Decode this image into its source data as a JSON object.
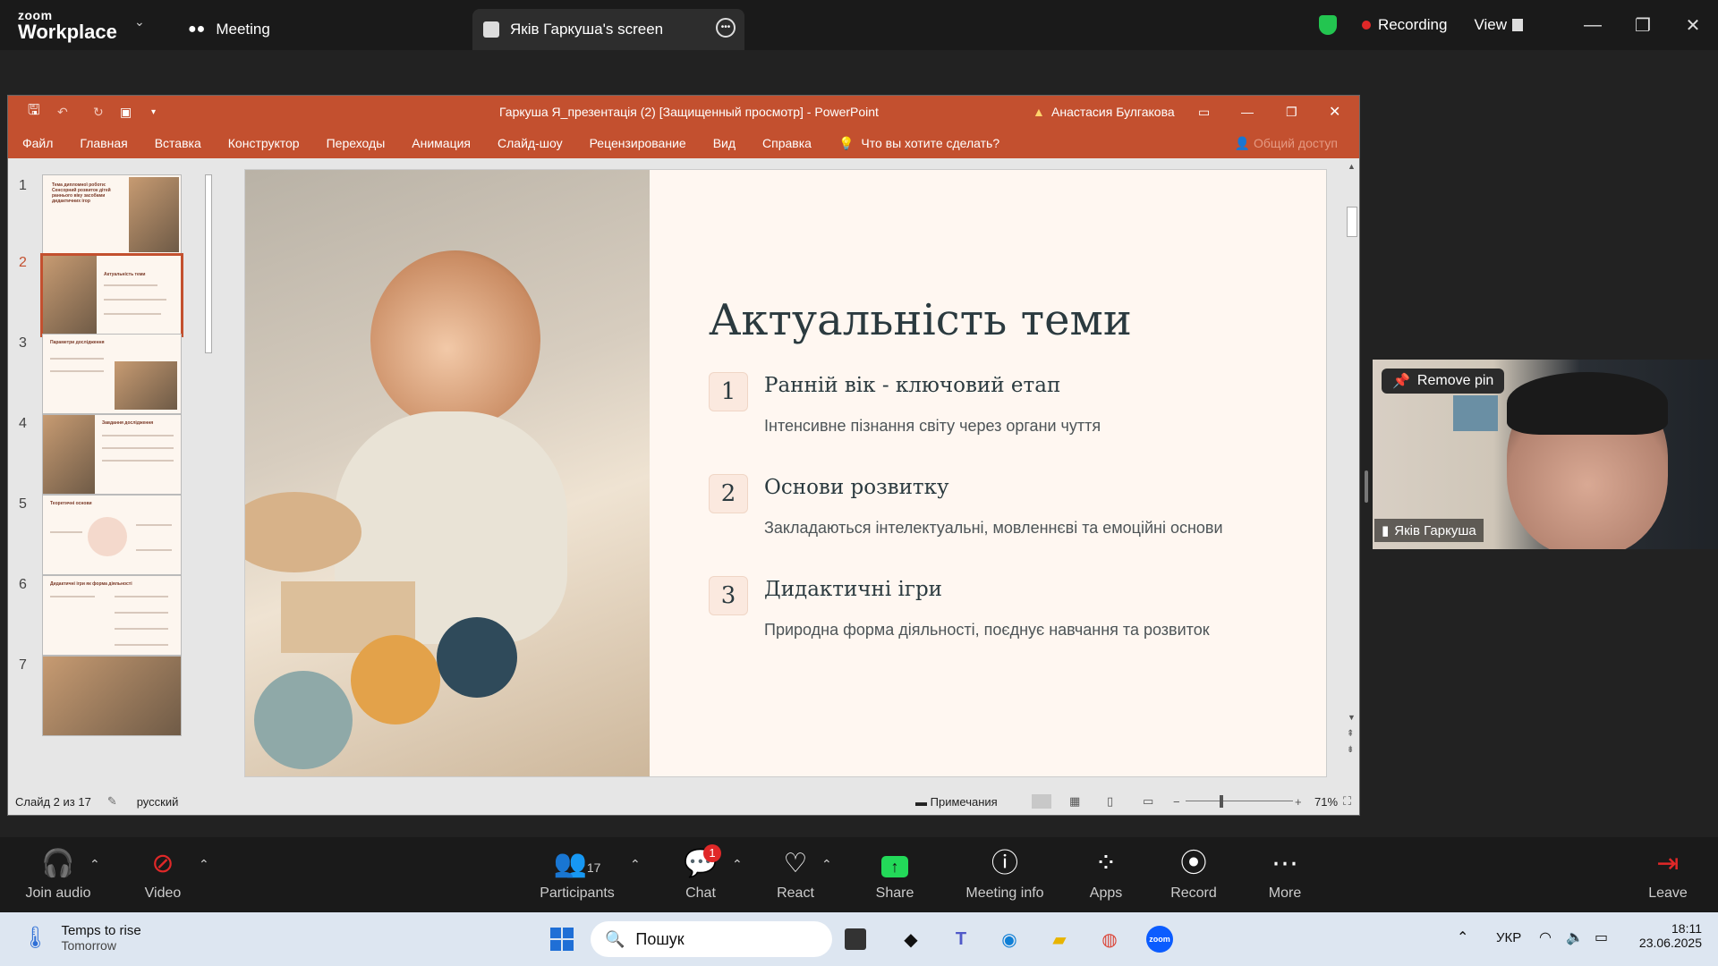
{
  "zoom": {
    "logo_line1": "zoom",
    "logo_line2": "Workplace",
    "meeting_tab": "Meeting",
    "share_tab": "Якiв Гаркуша's screen",
    "recording": "Recording",
    "view": "View"
  },
  "ppt": {
    "title": "Гаркуша Я_презентація (2) [Защищенный просмотр] - PowerPoint",
    "user": "Анастасия Булгакова",
    "ribbon": [
      "Файл",
      "Главная",
      "Вставка",
      "Конструктор",
      "Переходы",
      "Анимация",
      "Слайд-шоу",
      "Рецензирование",
      "Вид",
      "Справка"
    ],
    "tell_me": "Что вы хотите сделать?",
    "share": "Общий доступ",
    "thumbnails": [
      {
        "num": "1",
        "label": "Тема дипломної роботи: Сенсорний розвиток дітей раннього віку засобами дидактичних ігор"
      },
      {
        "num": "2",
        "label": "Актуальність теми"
      },
      {
        "num": "3",
        "label": "Параметри дослідження"
      },
      {
        "num": "4",
        "label": "Завдання дослідження"
      },
      {
        "num": "5",
        "label": "Теоретичні основи"
      },
      {
        "num": "6",
        "label": "Дидактичні ігри як форма діяльності"
      },
      {
        "num": "7",
        "label": ""
      }
    ],
    "slide": {
      "title": "Актуальність теми",
      "points": [
        {
          "num": "1",
          "title": "Ранній вік - ключовий етап",
          "desc": "Інтенсивне пізнання світу через органи чуття"
        },
        {
          "num": "2",
          "title": "Основи розвитку",
          "desc": "Закладаються інтелектуальні, мовленнєві та емоційні основи"
        },
        {
          "num": "3",
          "title": "Дидактичні ігри",
          "desc": "Природна форма діяльності, поєднує навчання та розвиток"
        }
      ]
    },
    "status": {
      "slide_of": "Слайд 2 из 17",
      "language": "русский",
      "notes": "Примечания",
      "zoom": "71%"
    }
  },
  "video": {
    "remove_pin": "Remove pin",
    "name": "Якiв Гаркуша"
  },
  "toolbar": {
    "join_audio": "Join audio",
    "video": "Video",
    "participants": "Participants",
    "participants_count": "17",
    "chat": "Chat",
    "chat_badge": "1",
    "react": "React",
    "share": "Share",
    "meeting_info": "Meeting info",
    "apps": "Apps",
    "record": "Record",
    "more": "More",
    "leave": "Leave"
  },
  "taskbar": {
    "weather_title": "Temps to rise",
    "weather_sub": "Tomorrow",
    "search": "Пошук",
    "lang": "УКР",
    "time": "18:11",
    "date": "23.06.2025"
  },
  "colors": {
    "ppt_accent": "#c3502f",
    "zoom_share_green": "#23d959",
    "recording_red": "#e02828"
  }
}
